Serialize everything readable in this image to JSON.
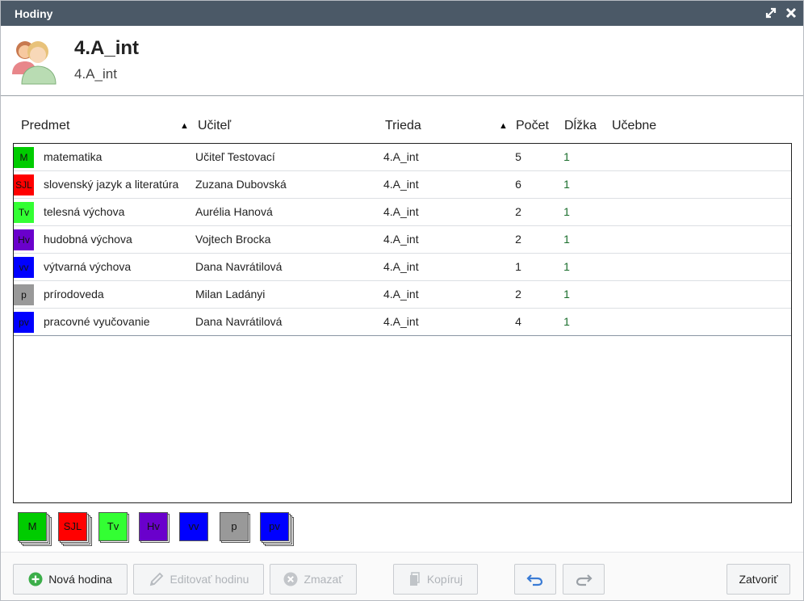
{
  "window": {
    "title": "Hodiny"
  },
  "header": {
    "title": "4.A_int",
    "subtitle": "4.A_int"
  },
  "columns": {
    "subject": "Predmet",
    "teacher": "Učiteľ",
    "class": "Trieda",
    "count": "Počet",
    "length": "Dĺžka",
    "rooms": "Učebne",
    "sort_indicator": "▲"
  },
  "rows": [
    {
      "abbr": "M",
      "subject": "matematika",
      "teacher": "Učiteľ Testovací",
      "class": "4.A_int",
      "count": "5",
      "length": "1",
      "color": "#00cc00"
    },
    {
      "abbr": "SJL",
      "subject": "slovenský jazyk a literatúra",
      "teacher": "Zuzana Dubovská",
      "class": "4.A_int",
      "count": "6",
      "length": "1",
      "color": "#ff0000"
    },
    {
      "abbr": "Tv",
      "subject": "telesná výchova",
      "teacher": "Aurélia Hanová",
      "class": "4.A_int",
      "count": "2",
      "length": "1",
      "color": "#33ff33"
    },
    {
      "abbr": "Hv",
      "subject": "hudobná výchova",
      "teacher": "Vojtech Brocka",
      "class": "4.A_int",
      "count": "2",
      "length": "1",
      "color": "#6a00cc"
    },
    {
      "abbr": "vv",
      "subject": "výtvarná výchova",
      "teacher": "Dana Navrátilová",
      "class": "4.A_int",
      "count": "1",
      "length": "1",
      "color": "#0000ff"
    },
    {
      "abbr": "p",
      "subject": "prírodoveda",
      "teacher": "Milan Ladányi",
      "class": "4.A_int",
      "count": "2",
      "length": "1",
      "color": "#999999"
    },
    {
      "abbr": "pv",
      "subject": "pracovné vyučovanie",
      "teacher": "Dana Navrátilová",
      "class": "4.A_int",
      "count": "4",
      "length": "1",
      "color": "#0000ff"
    }
  ],
  "cards": [
    {
      "abbr": "M",
      "color": "#00cc00"
    },
    {
      "abbr": "SJL",
      "color": "#ff0000"
    },
    {
      "abbr": "Tv",
      "color": "#33ff33"
    },
    {
      "abbr": "Hv",
      "color": "#6a00cc"
    },
    {
      "abbr": "vv",
      "color": "#0000ff"
    },
    {
      "abbr": "p",
      "color": "#999999"
    },
    {
      "abbr": "pv",
      "color": "#0000ff"
    }
  ],
  "footer": {
    "new_label": "Nová hodina",
    "edit_label": "Editovať hodinu",
    "delete_label": "Zmazať",
    "copy_label": "Kopíruj",
    "close_label": "Zatvoriť"
  },
  "icons": {
    "maximize": "maximize-icon",
    "close": "close-icon",
    "avatar": "users-avatar-icon",
    "new": "plus-circle-icon",
    "edit": "pencil-icon",
    "delete": "x-circle-icon",
    "copy": "copy-icon",
    "undo": "undo-icon",
    "redo": "redo-icon"
  }
}
